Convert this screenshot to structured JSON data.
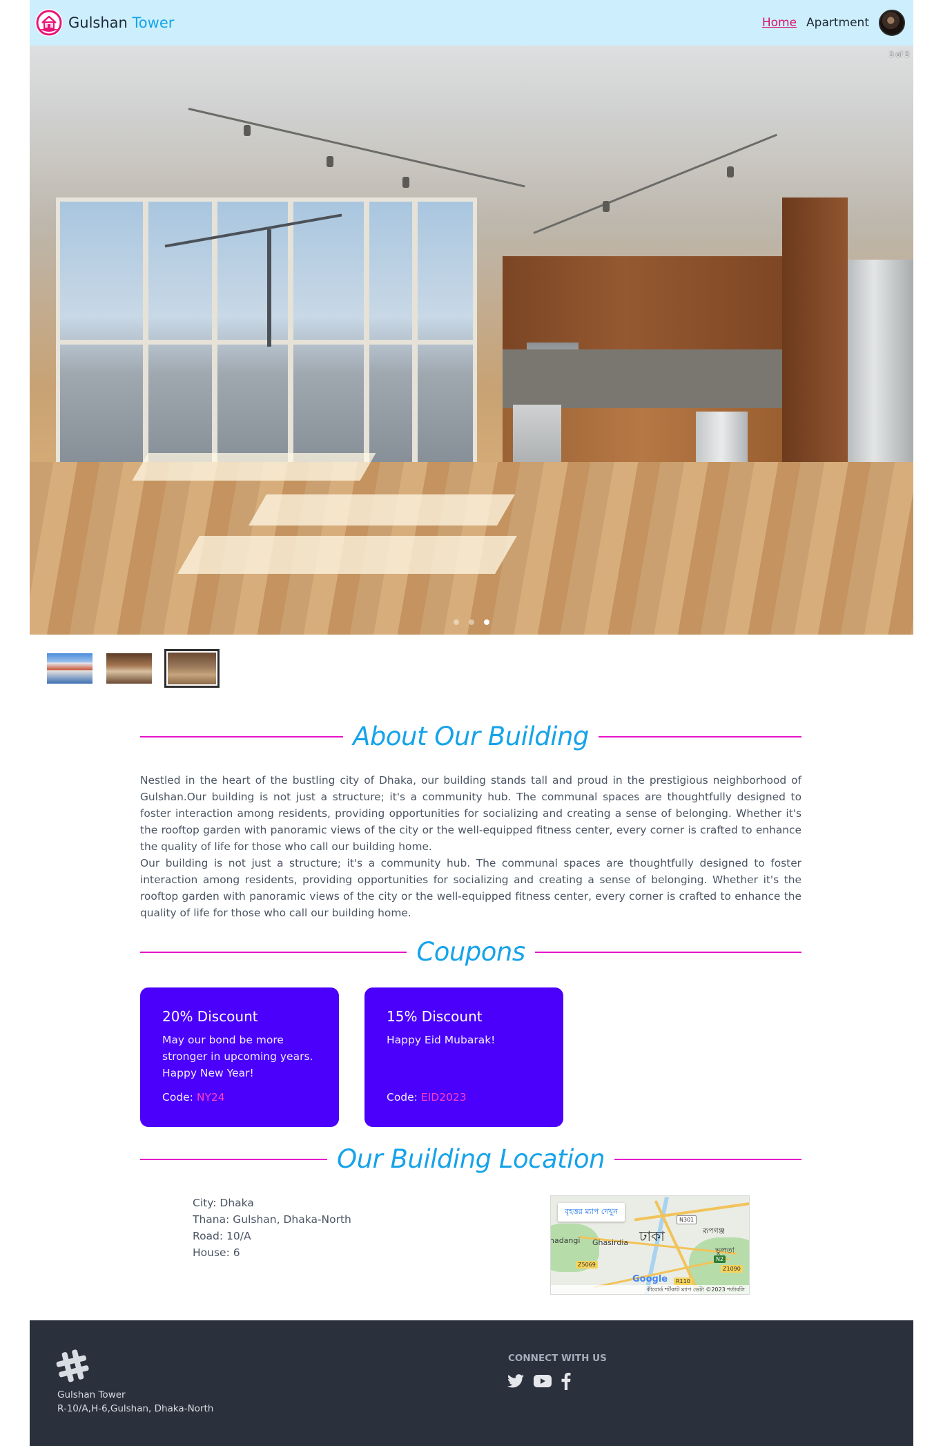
{
  "navbar": {
    "brand_primary": "Gulshan",
    "brand_accent": "Tower",
    "links": [
      {
        "label": "Home",
        "active": true
      },
      {
        "label": "Apartment",
        "active": false
      }
    ]
  },
  "carousel": {
    "counter": "3 of 3",
    "slide_count": 3,
    "active_slide": 3
  },
  "about": {
    "title": "About Our Building",
    "paragraphs": [
      "Nestled in the heart of the bustling city of Dhaka, our building stands tall and proud in the prestigious neighborhood of Gulshan.Our building is not just a structure; it's a community hub. The communal spaces are thoughtfully designed to foster interaction among residents, providing opportunities for socializing and creating a sense of belonging. Whether it's the rooftop garden with panoramic views of the city or the well-equipped fitness center, every corner is crafted to enhance the quality of life for those who call our building home.",
      "Our building is not just a structure; it's a community hub. The communal spaces are thoughtfully designed to foster interaction among residents, providing opportunities for socializing and creating a sense of belonging. Whether it's the rooftop garden with panoramic views of the city or the well-equipped fitness center, every corner is crafted to enhance the quality of life for those who call our building home."
    ]
  },
  "coupons": {
    "title": "Coupons",
    "code_label": "Code:",
    "items": [
      {
        "title": "20% Discount",
        "description": "May our bond be more stronger in upcoming years. Happy New Year!",
        "code": "NY24"
      },
      {
        "title": "15% Discount",
        "description": "Happy Eid Mubarak!",
        "code": "EID2023"
      }
    ]
  },
  "location": {
    "title": "Our Building Location",
    "lines": [
      "City: Dhaka",
      "Thana: Gulshan, Dhaka-North",
      "Road: 10/A",
      "House: 6"
    ]
  },
  "map": {
    "button": "বৃহত্তর ম্যাপ দেখুন",
    "city_label": "ঢাকা",
    "labels": [
      "nadangi",
      "Ghasirdia",
      "রূপগঞ্জ",
      "ভুলতা"
    ],
    "badges": [
      "N301",
      "N2",
      "Z5069",
      "Z1090",
      "R110"
    ],
    "brand": "Google",
    "footer": "কীবোর্ড শর্টকাট   ম্যাপ ডেটা ©2023   শর্তাবলি"
  },
  "footer": {
    "name": "Gulshan Tower",
    "address": "R-10/A,H-6,Gulshan, Dhaka-North",
    "connect_heading": "CONNECT WITH US",
    "social_icons": [
      "twitter-icon",
      "youtube-icon",
      "facebook-icon"
    ]
  },
  "colors": {
    "nav_bg": "#cdeffd",
    "accent_blue": "#16a3e9",
    "accent_pink": "#e712c9",
    "coupon_bg": "#4a00fb",
    "coupon_code": "#ff3dc8",
    "footer_bg": "#2a303c"
  }
}
